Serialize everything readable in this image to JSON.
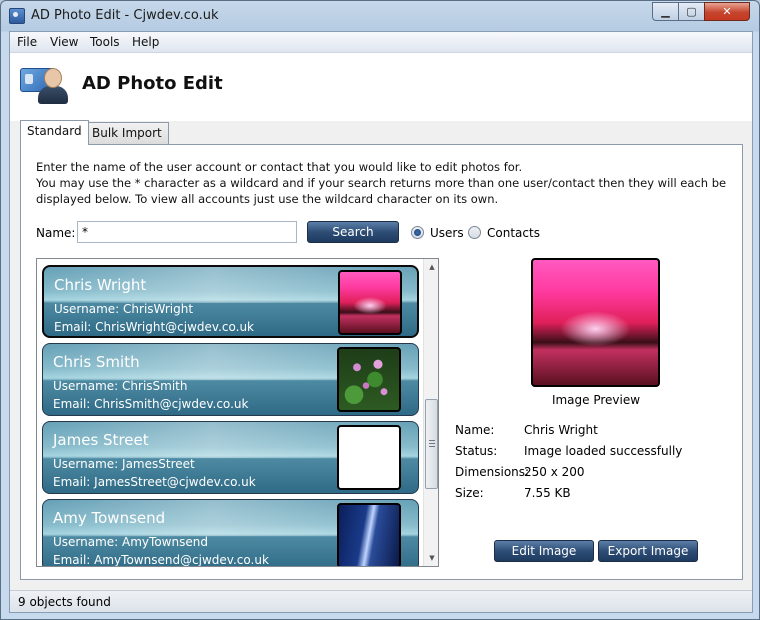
{
  "window": {
    "title": "AD Photo Edit - Cjwdev.co.uk"
  },
  "menu": [
    "File",
    "View",
    "Tools",
    "Help"
  ],
  "header": {
    "title": "AD Photo Edit"
  },
  "tabs": [
    {
      "label": "Standard",
      "active": true
    },
    {
      "label": "Bulk Import",
      "active": false
    }
  ],
  "intro": {
    "line1": "Enter the name of the user account or contact that you would like to edit photos for.",
    "line2": "You may use the * character as a wildcard and if your search returns more than one user/contact then they will each be displayed below. To view all accounts just use the wildcard character on its own."
  },
  "search": {
    "label": "Name:",
    "value": "*",
    "button": "Search",
    "options": [
      {
        "label": "Users",
        "selected": true
      },
      {
        "label": "Contacts",
        "selected": false
      }
    ]
  },
  "results": [
    {
      "name": "Chris Wright",
      "username": "Username: ChrisWright",
      "email": "Email: ChrisWright@cjwdev.co.uk",
      "thumb": "sunset",
      "selected": true
    },
    {
      "name": "Chris Smith",
      "username": "Username: ChrisSmith",
      "email": "Email: ChrisSmith@cjwdev.co.uk",
      "thumb": "flowers",
      "selected": false
    },
    {
      "name": "James Street",
      "username": "Username: JamesStreet",
      "email": "Email: JamesStreet@cjwdev.co.uk",
      "thumb": "blank",
      "selected": false
    },
    {
      "name": "Amy Townsend",
      "username": "Username: AmyTownsend",
      "email": "Email: AmyTownsend@cjwdev.co.uk",
      "thumb": "waves",
      "selected": false
    }
  ],
  "preview": {
    "label": "Image Preview",
    "info": [
      {
        "key": "Name:",
        "value": "Chris Wright"
      },
      {
        "key": "Status:",
        "value": "Image loaded successfully"
      },
      {
        "key": "Dimensions:",
        "value": "250 x 200"
      },
      {
        "key": "Size:",
        "value": "7.55 KB"
      }
    ],
    "edit_button": "Edit Image",
    "export_button": "Export Image"
  },
  "status": {
    "text": "9 objects found"
  }
}
